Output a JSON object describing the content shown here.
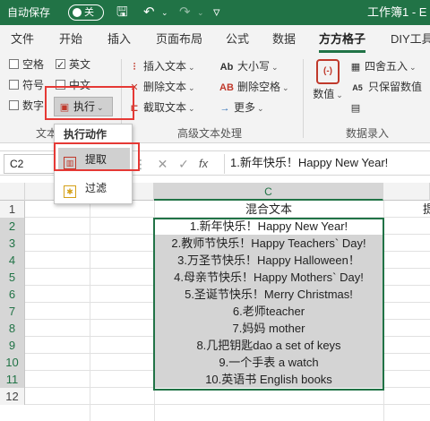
{
  "titlebar": {
    "autosave_label": "自动保存",
    "autosave_state": "关",
    "doc_title": "工作簿1 - E"
  },
  "tabs": [
    "文件",
    "开始",
    "插入",
    "页面布局",
    "公式",
    "数据",
    "方方格子",
    "DIY工具"
  ],
  "active_tab": "方方格子",
  "ribbon": {
    "checkboxes": [
      {
        "label": "空格",
        "checked": false
      },
      {
        "label": "英文",
        "checked": true
      },
      {
        "label": "符号",
        "checked": false
      },
      {
        "label": "中文",
        "checked": false
      },
      {
        "label": "数字",
        "checked": false
      }
    ],
    "execute_label": "执行",
    "text_group_label": "文本",
    "insert_text": "插入文本",
    "delete_text": "删除文本",
    "extract_text": "截取文本",
    "case_label": "大小写",
    "delete_spaces": "删除空格",
    "more_label": "更多",
    "adv_group_label": "高级文本处理",
    "numeric_label": "数值",
    "round_label": "四舍五入",
    "keep_numeric_label": "只保留数值",
    "data_entry_group_label": "数据录入"
  },
  "dropdown": {
    "header": "执行动作",
    "items": [
      "提取",
      "过滤"
    ]
  },
  "formula_bar": {
    "cell_ref": "C2",
    "fx": "fx",
    "content": "1.新年快乐！Happy New Year!"
  },
  "grid": {
    "columns": [
      "C"
    ],
    "row_numbers": [
      "1",
      "2",
      "3",
      "4",
      "5",
      "6",
      "7",
      "8",
      "9",
      "10",
      "11",
      "12"
    ],
    "cells_c": [
      "混合文本",
      "1.新年快乐！Happy New Year!",
      "2.教师节快乐！Happy Teachers` Day!",
      "3.万圣节快乐！Happy Halloween！",
      "4.母亲节快乐！Happy Mothers` Day!",
      "5.圣诞节快乐！Merry Christmas!",
      "6.老师teacher",
      "7.妈妈 mother",
      "8.几把钥匙dao a set of keys",
      "9.一个手表 a watch",
      "10.英语书 English books",
      ""
    ],
    "cell_d1": "提"
  },
  "colors": {
    "excel_green": "#217346",
    "highlight_red": "#e53935"
  }
}
